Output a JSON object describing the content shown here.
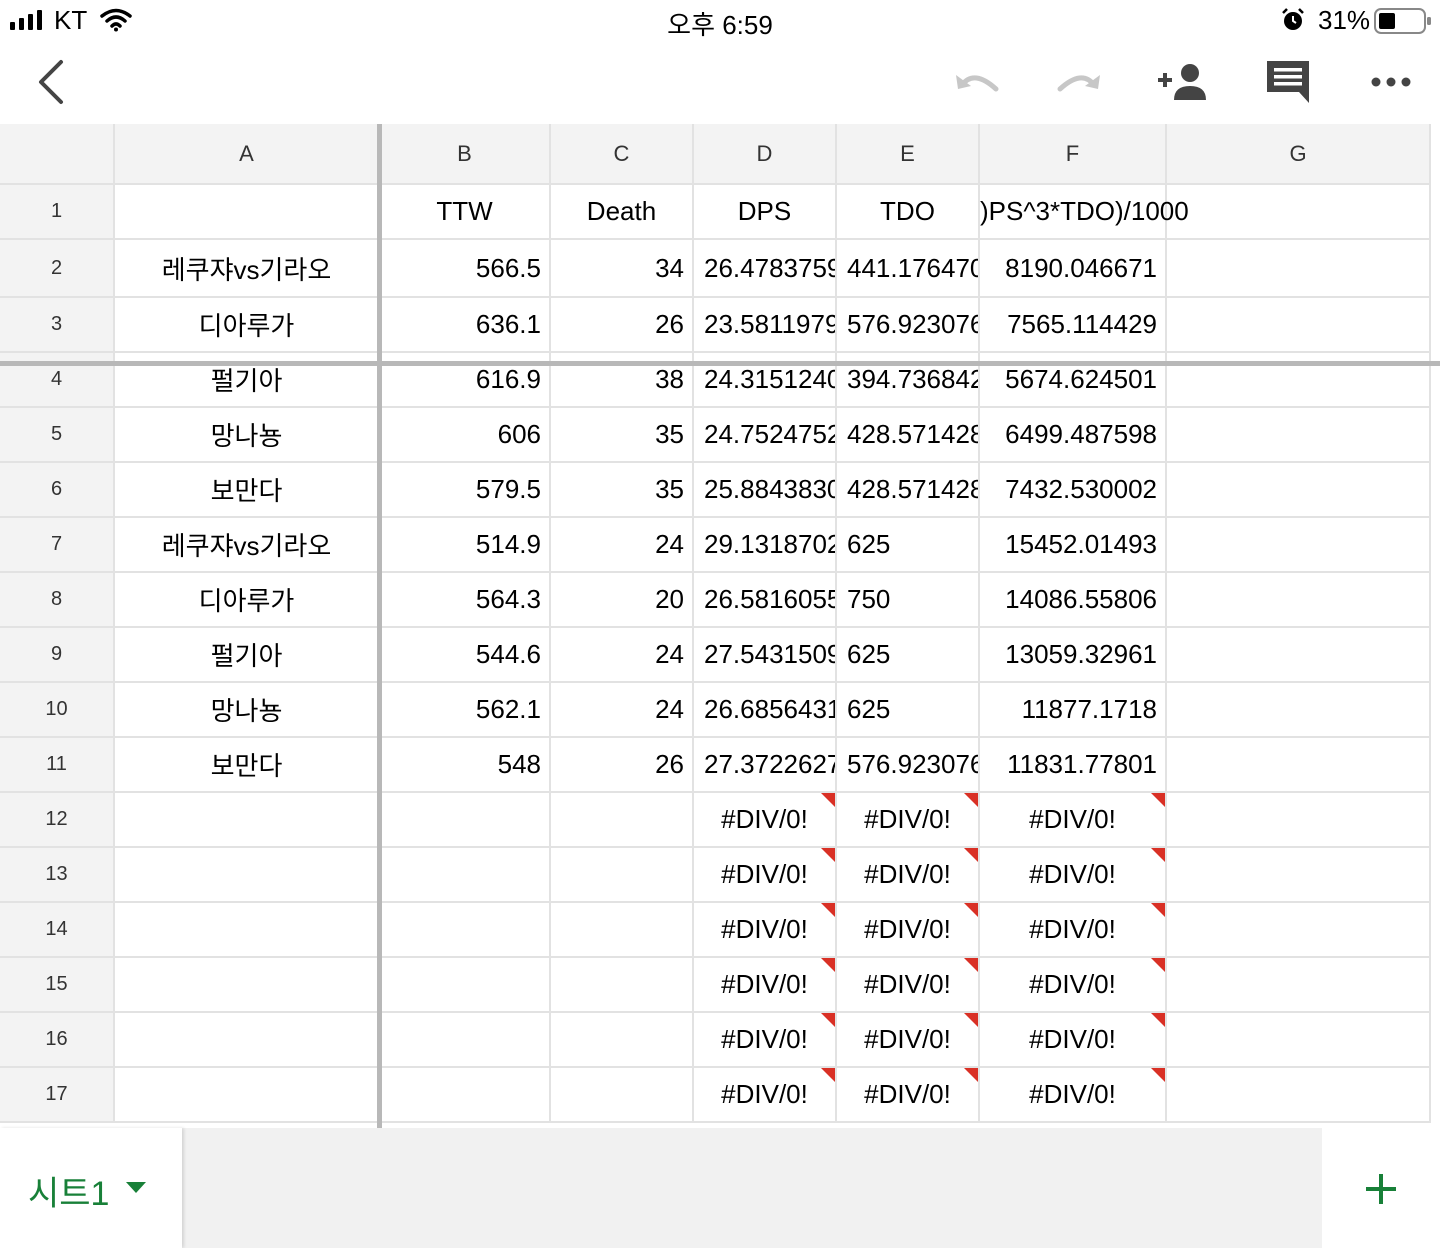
{
  "status_bar": {
    "carrier": "KT",
    "time": "오후 6:59",
    "battery": "31%"
  },
  "toolbar": {
    "icons": [
      "back-icon",
      "undo-icon",
      "redo-icon",
      "add-person-icon",
      "comment-icon",
      "more-icon"
    ]
  },
  "columns": [
    "A",
    "B",
    "C",
    "D",
    "E",
    "F",
    "G"
  ],
  "header_row": {
    "row": "1",
    "A": "",
    "B": "TTW",
    "C": "Death",
    "D": "DPS",
    "E": "TDO",
    "F": ")PS^3*TDO)/1000",
    "G": ""
  },
  "rows": [
    {
      "row": "2",
      "A": "레쿠쟈vs기라오",
      "B": "566.5",
      "C": "34",
      "D": "26.4783759",
      "E": "441.176470",
      "F": "8190.046671",
      "G": ""
    },
    {
      "row": "3",
      "A": "디아루가",
      "B": "636.1",
      "C": "26",
      "D": "23.5811979",
      "E": "576.923076",
      "F": "7565.114429",
      "G": ""
    },
    {
      "row": "4",
      "A": "펄기아",
      "B": "616.9",
      "C": "38",
      "D": "24.3151240",
      "E": "394.736842",
      "F": "5674.624501",
      "G": ""
    },
    {
      "row": "5",
      "A": "망나뇽",
      "B": "606",
      "C": "35",
      "D": "24.7524752",
      "E": "428.571428",
      "F": "6499.487598",
      "G": ""
    },
    {
      "row": "6",
      "A": "보만다",
      "B": "579.5",
      "C": "35",
      "D": "25.8843830",
      "E": "428.571428",
      "F": "7432.530002",
      "G": ""
    },
    {
      "row": "7",
      "A": "레쿠쟈vs기라오",
      "B": "514.9",
      "C": "24",
      "D": "29.1318702",
      "E": "625",
      "F": "15452.01493",
      "G": ""
    },
    {
      "row": "8",
      "A": "디아루가",
      "B": "564.3",
      "C": "20",
      "D": "26.5816055",
      "E": "750",
      "F": "14086.55806",
      "G": ""
    },
    {
      "row": "9",
      "A": "펄기아",
      "B": "544.6",
      "C": "24",
      "D": "27.5431509",
      "E": "625",
      "F": "13059.32961",
      "G": ""
    },
    {
      "row": "10",
      "A": "망나뇽",
      "B": "562.1",
      "C": "24",
      "D": "26.6856431",
      "E": "625",
      "F": "11877.1718",
      "G": ""
    },
    {
      "row": "11",
      "A": "보만다",
      "B": "548",
      "C": "26",
      "D": "27.3722627",
      "E": "576.923076",
      "F": "11831.77801",
      "G": ""
    },
    {
      "row": "12",
      "A": "",
      "B": "",
      "C": "",
      "D": "#DIV/0!",
      "E": "#DIV/0!",
      "F": "#DIV/0!",
      "G": ""
    },
    {
      "row": "13",
      "A": "",
      "B": "",
      "C": "",
      "D": "#DIV/0!",
      "E": "#DIV/0!",
      "F": "#DIV/0!",
      "G": ""
    },
    {
      "row": "14",
      "A": "",
      "B": "",
      "C": "",
      "D": "#DIV/0!",
      "E": "#DIV/0!",
      "F": "#DIV/0!",
      "G": ""
    },
    {
      "row": "15",
      "A": "",
      "B": "",
      "C": "",
      "D": "#DIV/0!",
      "E": "#DIV/0!",
      "F": "#DIV/0!",
      "G": ""
    },
    {
      "row": "16",
      "A": "",
      "B": "",
      "C": "",
      "D": "#DIV/0!",
      "E": "#DIV/0!",
      "F": "#DIV/0!",
      "G": ""
    },
    {
      "row": "17",
      "A": "",
      "B": "",
      "C": "",
      "D": "#DIV/0!",
      "E": "#DIV/0!",
      "F": "#DIV/0!",
      "G": ""
    }
  ],
  "sheet_tabs": [
    {
      "label": "시트1"
    }
  ],
  "colors": {
    "accent": "#188038",
    "error_marker": "#d93025",
    "header_bg": "#f3f3f3",
    "grid_line": "#e2e2e2",
    "freeze_line": "#b8b8b8"
  }
}
